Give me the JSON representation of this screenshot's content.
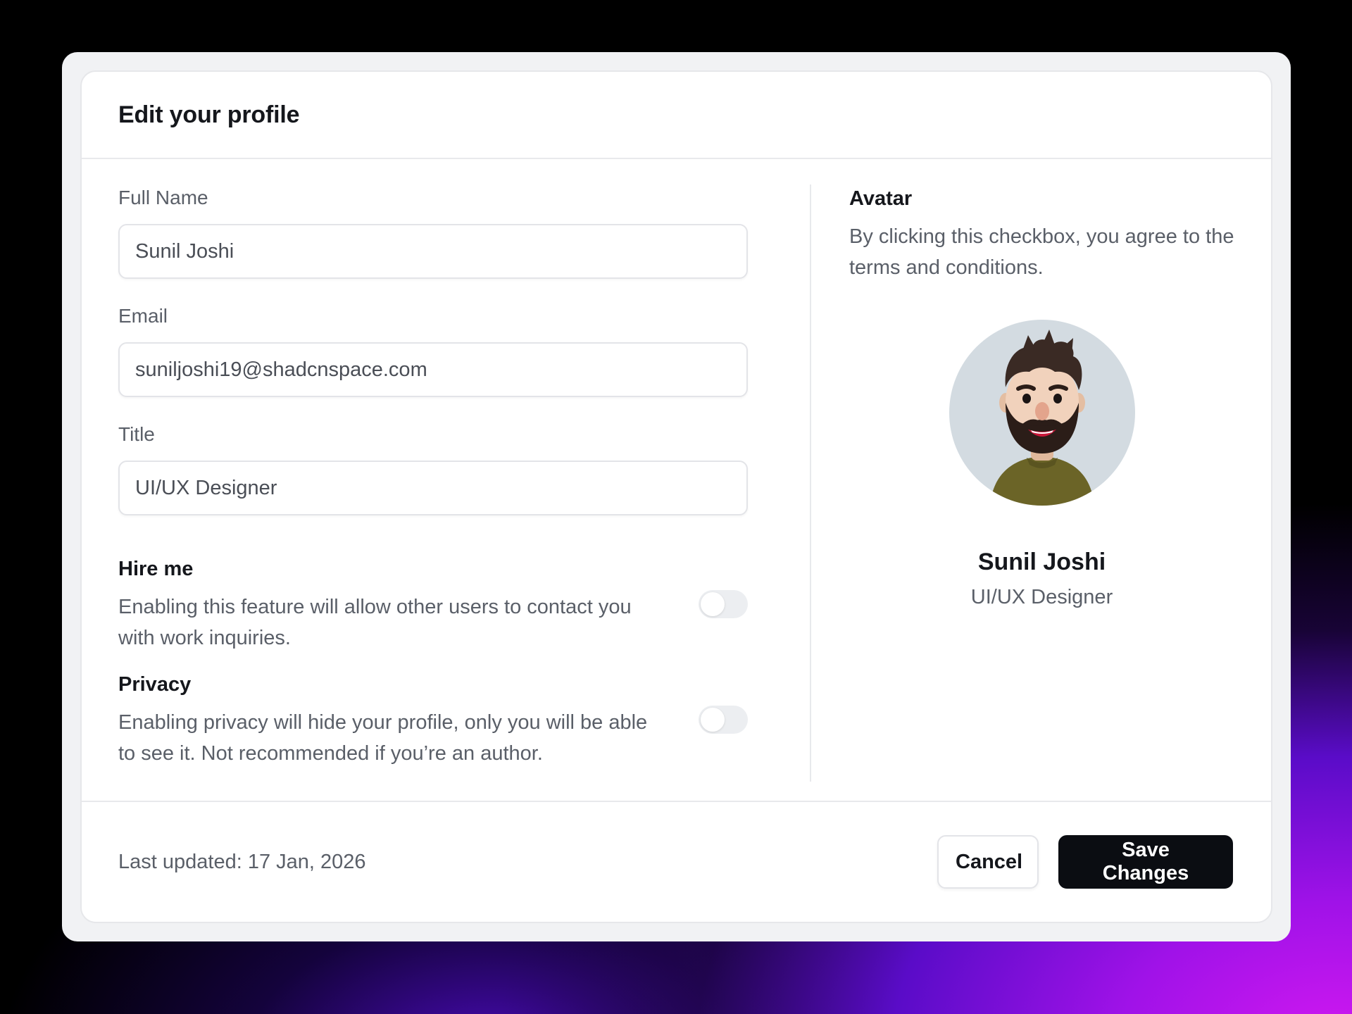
{
  "dialog": {
    "title": "Edit your profile"
  },
  "form": {
    "full_name": {
      "label": "Full Name",
      "value": "Sunil Joshi"
    },
    "email": {
      "label": "Email",
      "value": "suniljoshi19@shadcnspace.com"
    },
    "title": {
      "label": "Title",
      "value": "UI/UX Designer"
    }
  },
  "toggles": {
    "hire_me": {
      "title": "Hire me",
      "description": "Enabling this feature will allow other users to contact you with work inquiries.",
      "enabled": false
    },
    "privacy": {
      "title": "Privacy",
      "description": "Enabling privacy will hide your profile, only you will be able to see it. Not recommended if you’re an author.",
      "enabled": false
    }
  },
  "avatar_section": {
    "heading": "Avatar",
    "description": "By clicking this checkbox, you agree to the terms and conditions.",
    "icon": "bearded-man-avatar",
    "name": "Sunil Joshi",
    "title": "UI/UX Designer"
  },
  "footer": {
    "last_updated": "Last updated: 17 Jan, 2026",
    "cancel_label": "Cancel",
    "save_label": "Save Changes"
  },
  "colors": {
    "primary_button": "#0b0d12",
    "avatar_background": "#d3dbe1"
  }
}
